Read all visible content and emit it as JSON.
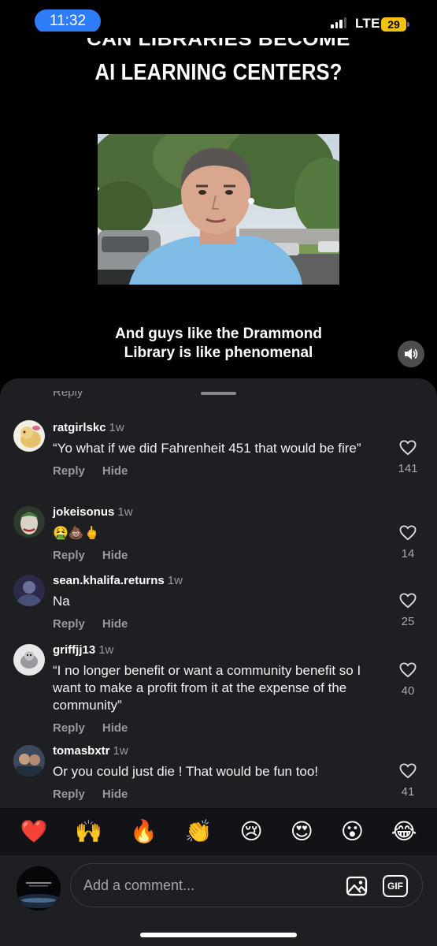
{
  "status_bar": {
    "time": "11:32",
    "network": "LTE",
    "battery": "29"
  },
  "video": {
    "title_cut": "CAN LIBRARIES BECOME",
    "title": "AI LEARNING CENTERS?",
    "caption_line1": "And guys like the Drammond",
    "caption_line2": "Library is like phenomenal",
    "mute_icon": "speaker-icon"
  },
  "comments": {
    "cut_reply_label": "Reply",
    "items": [
      {
        "username": "ratgirlskc",
        "time": "1w",
        "text": "“Yo what if we did Fahrenheit 451 that would be fire”",
        "likes": "141",
        "reply": "Reply",
        "hide": "Hide"
      },
      {
        "username": "jokeisonus",
        "time": "1w",
        "text": "🤮💩🖕",
        "likes": "14",
        "reply": "Reply",
        "hide": "Hide"
      },
      {
        "username": "sean.khalifa.returns",
        "time": "1w",
        "text": "Na",
        "likes": "25",
        "reply": "Reply",
        "hide": "Hide"
      },
      {
        "username": "griffjj13",
        "time": "1w",
        "text": "“I no longer benefit or want a community benefit so I want to make a profit from it at the expense of the community”",
        "likes": "40",
        "reply": "Reply",
        "hide": "Hide"
      },
      {
        "username": "tomasbxtr",
        "time": "1w",
        "text": "Or you could just die ! That would be fun too!",
        "likes": "41",
        "reply": "Reply",
        "hide": "Hide"
      }
    ]
  },
  "reactions": [
    "❤️",
    "🙌",
    "🔥",
    "👏",
    "😢",
    "😍",
    "😮",
    "😂"
  ],
  "input": {
    "placeholder": "Add a comment...",
    "gif_label": "GIF",
    "image_icon": "image-icon"
  },
  "colors": {
    "sheet_bg": "#1e1f23",
    "accent_time": "#2f7df6",
    "battery": "#f1c20f"
  }
}
